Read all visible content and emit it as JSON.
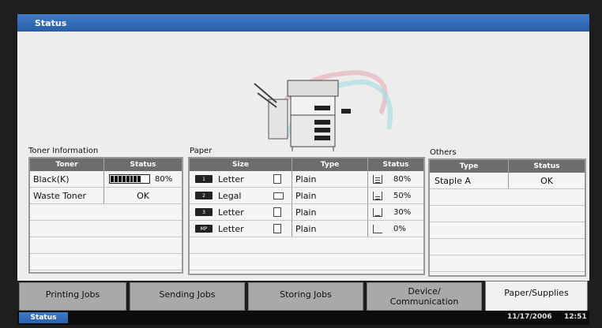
{
  "window": {
    "title": "Status"
  },
  "toner": {
    "section_label": "Toner Information",
    "headers": [
      "Toner",
      "Status"
    ],
    "rows": [
      {
        "name": "Black(K)",
        "level_pct": 80,
        "level_label": "80%"
      },
      {
        "name": "Waste Toner",
        "status": "OK"
      }
    ]
  },
  "paper": {
    "section_label": "Paper",
    "headers": [
      "Size",
      "Type",
      "Status"
    ],
    "rows": [
      {
        "tray": "1",
        "size": "Letter",
        "orientation": "portrait",
        "type": "Plain",
        "level_pct": 80,
        "level_label": "80%"
      },
      {
        "tray": "2",
        "size": "Legal",
        "orientation": "landscape",
        "type": "Plain",
        "level_pct": 50,
        "level_label": "50%"
      },
      {
        "tray": "3",
        "size": "Letter",
        "orientation": "portrait",
        "type": "Plain",
        "level_pct": 30,
        "level_label": "30%"
      },
      {
        "tray": "MP",
        "size": "Letter",
        "orientation": "portrait",
        "type": "Plain",
        "level_pct": 0,
        "level_label": "0%"
      }
    ]
  },
  "others": {
    "section_label": "Others",
    "headers": [
      "Type",
      "Status"
    ],
    "rows": [
      {
        "type": "Staple A",
        "status": "OK"
      }
    ]
  },
  "tabs": [
    {
      "label": "Printing Jobs",
      "active": false
    },
    {
      "label": "Sending Jobs",
      "active": false
    },
    {
      "label": "Storing Jobs",
      "active": false
    },
    {
      "label": "Device/\nCommunication",
      "active": false
    },
    {
      "label": "Paper/Supplies",
      "active": true
    }
  ],
  "statusbar": {
    "status_button": "Status",
    "date": "11/17/2006",
    "time": "12:51"
  },
  "icons": {
    "printer": "printer-illustration-icon",
    "tray": "paper-tray-icon",
    "paper": "paper-sheet-icon",
    "stack": "paper-stack-icon"
  }
}
